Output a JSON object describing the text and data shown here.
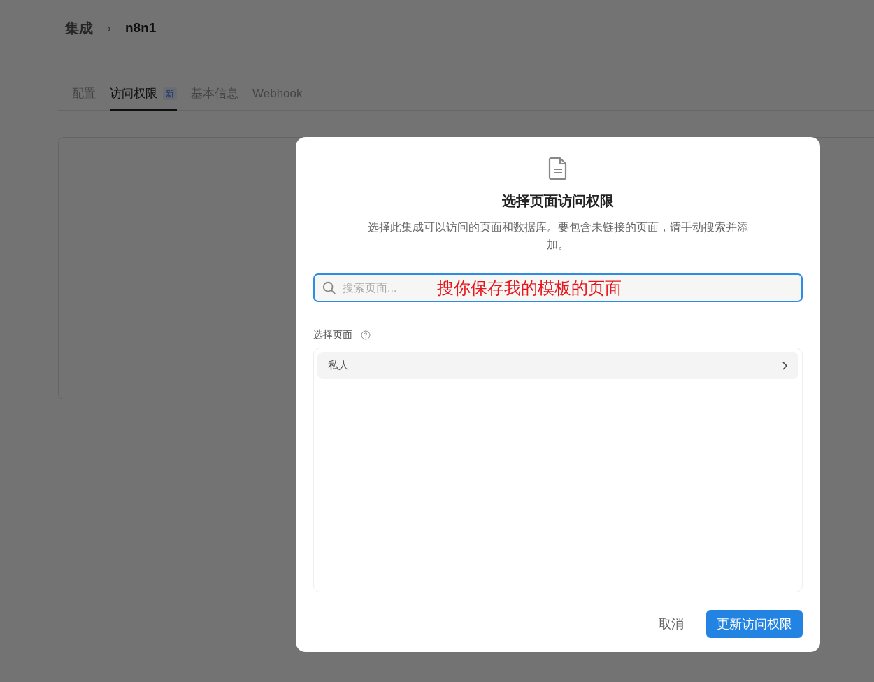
{
  "breadcrumb": {
    "parent": "集成",
    "separator": "›",
    "current": "n8n1"
  },
  "tabs": [
    {
      "label": "配置",
      "selected": false
    },
    {
      "label": "访问权限",
      "selected": true,
      "badge": "新"
    },
    {
      "label": "基本信息",
      "selected": false
    },
    {
      "label": "Webhook",
      "selected": false
    }
  ],
  "dialog": {
    "title": "选择页面访问权限",
    "description": "选择此集成可以访问的页面和数据库。要包含未链接的页面，请手动搜索并添加。",
    "search": {
      "placeholder": "搜索页面...",
      "focused": true
    },
    "annotation": "搜你保存我的模板的页面",
    "section_label": "选择页面",
    "pages": [
      {
        "label": "私人"
      }
    ],
    "buttons": {
      "cancel": "取消",
      "confirm": "更新访问权限"
    }
  }
}
